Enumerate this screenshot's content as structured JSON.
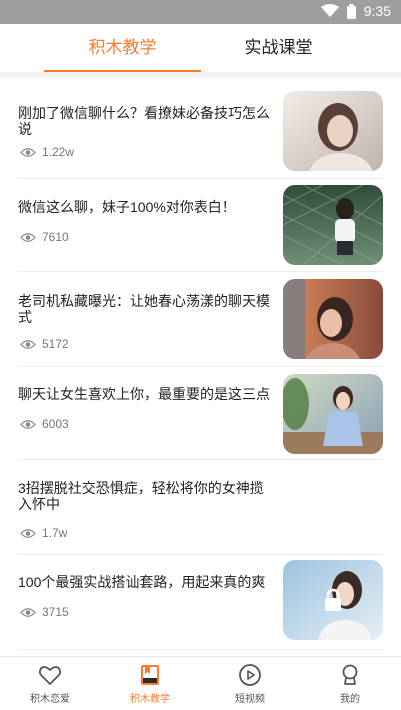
{
  "status_bar": {
    "time": "9:35",
    "icons": [
      "wifi-icon",
      "battery-icon"
    ]
  },
  "tabs": [
    {
      "label": "积木教学",
      "active": true
    },
    {
      "label": "实战课堂",
      "active": false
    }
  ],
  "articles": [
    {
      "title": "刚加了微信聊什么？看撩妹必备技巧怎么说",
      "views": "1.22w",
      "has_thumb": true
    },
    {
      "title": "微信这么聊，妹子100%对你表白！",
      "views": "7610",
      "has_thumb": true
    },
    {
      "title": "老司机私藏曝光：让她春心荡漾的聊天模式",
      "views": "5172",
      "has_thumb": true
    },
    {
      "title": "聊天让女生喜欢上你，最重要的是这三点",
      "views": "6003",
      "has_thumb": true
    },
    {
      "title": "3招摆脱社交恐惧症，轻松将你的女神揽入怀中",
      "views": "1.7w",
      "has_thumb": false
    },
    {
      "title": "100个最强实战搭讪套路，用起来真的爽",
      "views": "3715",
      "has_thumb": true
    }
  ],
  "bottom_nav": [
    {
      "label": "积木恋爱",
      "icon": "heart-icon",
      "active": false
    },
    {
      "label": "积木教学",
      "icon": "book-icon",
      "active": true
    },
    {
      "label": "短视频",
      "icon": "play-icon",
      "active": false
    },
    {
      "label": "我的",
      "icon": "profile-icon",
      "active": false
    }
  ],
  "colors": {
    "accent": "#ff7a2f",
    "statusbar": "#9e9e9e"
  }
}
